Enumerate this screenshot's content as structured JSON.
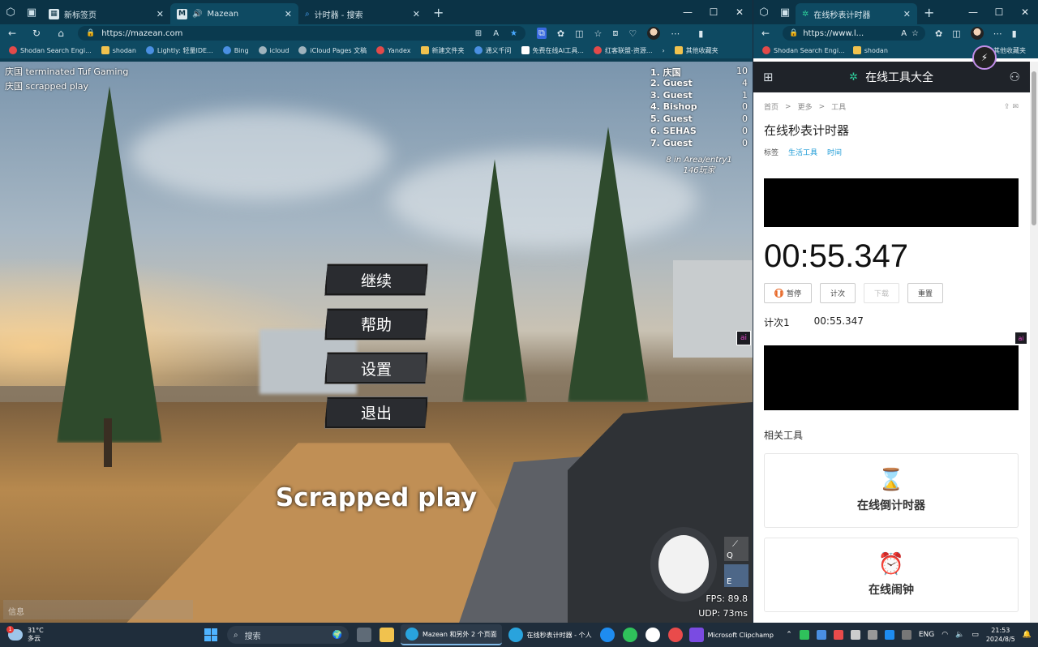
{
  "left_browser": {
    "tabs": [
      {
        "label": "新标签页"
      },
      {
        "label": "Mazean",
        "favicon": "M"
      },
      {
        "label": "计时器 - 搜索"
      }
    ],
    "url": "https://mazean.com",
    "bookmarks": [
      "Shodan Search Engi...",
      "shodan",
      "Lightly: 轻量IDE...",
      "Bing",
      "icloud",
      "iCloud Pages 文稿",
      "Yandex",
      "新建文件夹",
      "通义千问",
      "免费在线AI工具...",
      "红客联盟-资源...",
      "其他收藏夹"
    ],
    "game": {
      "killfeed": [
        "庆国 terminated Tuf Gaming",
        "庆国 scrapped play"
      ],
      "leaderboard": [
        {
          "name": "1. 庆国",
          "score": "10"
        },
        {
          "name": "2. Guest",
          "score": "4"
        },
        {
          "name": "3. Guest",
          "score": "1"
        },
        {
          "name": "4. Bishop",
          "score": "0"
        },
        {
          "name": "5. Guest",
          "score": "0"
        },
        {
          "name": "6. SEHAS",
          "score": "0"
        },
        {
          "name": "7. Guest",
          "score": "0"
        }
      ],
      "area_info": "8 in Area/entry1",
      "players_info": "146玩家",
      "menu": {
        "continue": "继续",
        "help": "帮助",
        "settings": "设置",
        "exit": "退出"
      },
      "big_message": "Scrapped play",
      "key_q": "Q",
      "key_e": "E",
      "fps": "FPS: 89.8",
      "udp": "UDP: 73ms",
      "chat_placeholder": "信息"
    }
  },
  "right_browser": {
    "tab_label": "在线秒表计时器",
    "url": "https://www.l...",
    "bookmarks": [
      "Shodan Search Engi...",
      "shodan",
      "其他收藏夹"
    ],
    "site_title": "在线工具大全",
    "breadcrumb": [
      "首页",
      "更多",
      "工具"
    ],
    "page_title": "在线秒表计时器",
    "tags_label": "标签",
    "tags": [
      "生活工具",
      "时间"
    ],
    "timer_display": "00:55.347",
    "buttons": {
      "pause": "暂停",
      "lap": "计次",
      "download": "下载",
      "reset": "重置"
    },
    "lap_label": "计次1",
    "lap_value": "00:55.347",
    "related_title": "相关工具",
    "related_tools": [
      {
        "icon": "hourglass-icon",
        "label": "在线倒计时器"
      },
      {
        "icon": "alarm-clock-icon",
        "label": "在线闹钟"
      }
    ]
  },
  "taskbar": {
    "temperature": "31°C",
    "condition": "多云",
    "weather_badge": "1",
    "search_placeholder": "搜索",
    "edge_app": "Mazean 和另外 2 个页面",
    "edge_app2": "在线秒表计时器 - 个人",
    "clipchamp": "Microsoft Clipchamp",
    "lang": "ENG",
    "time": "21:53",
    "date": "2024/8/5"
  }
}
